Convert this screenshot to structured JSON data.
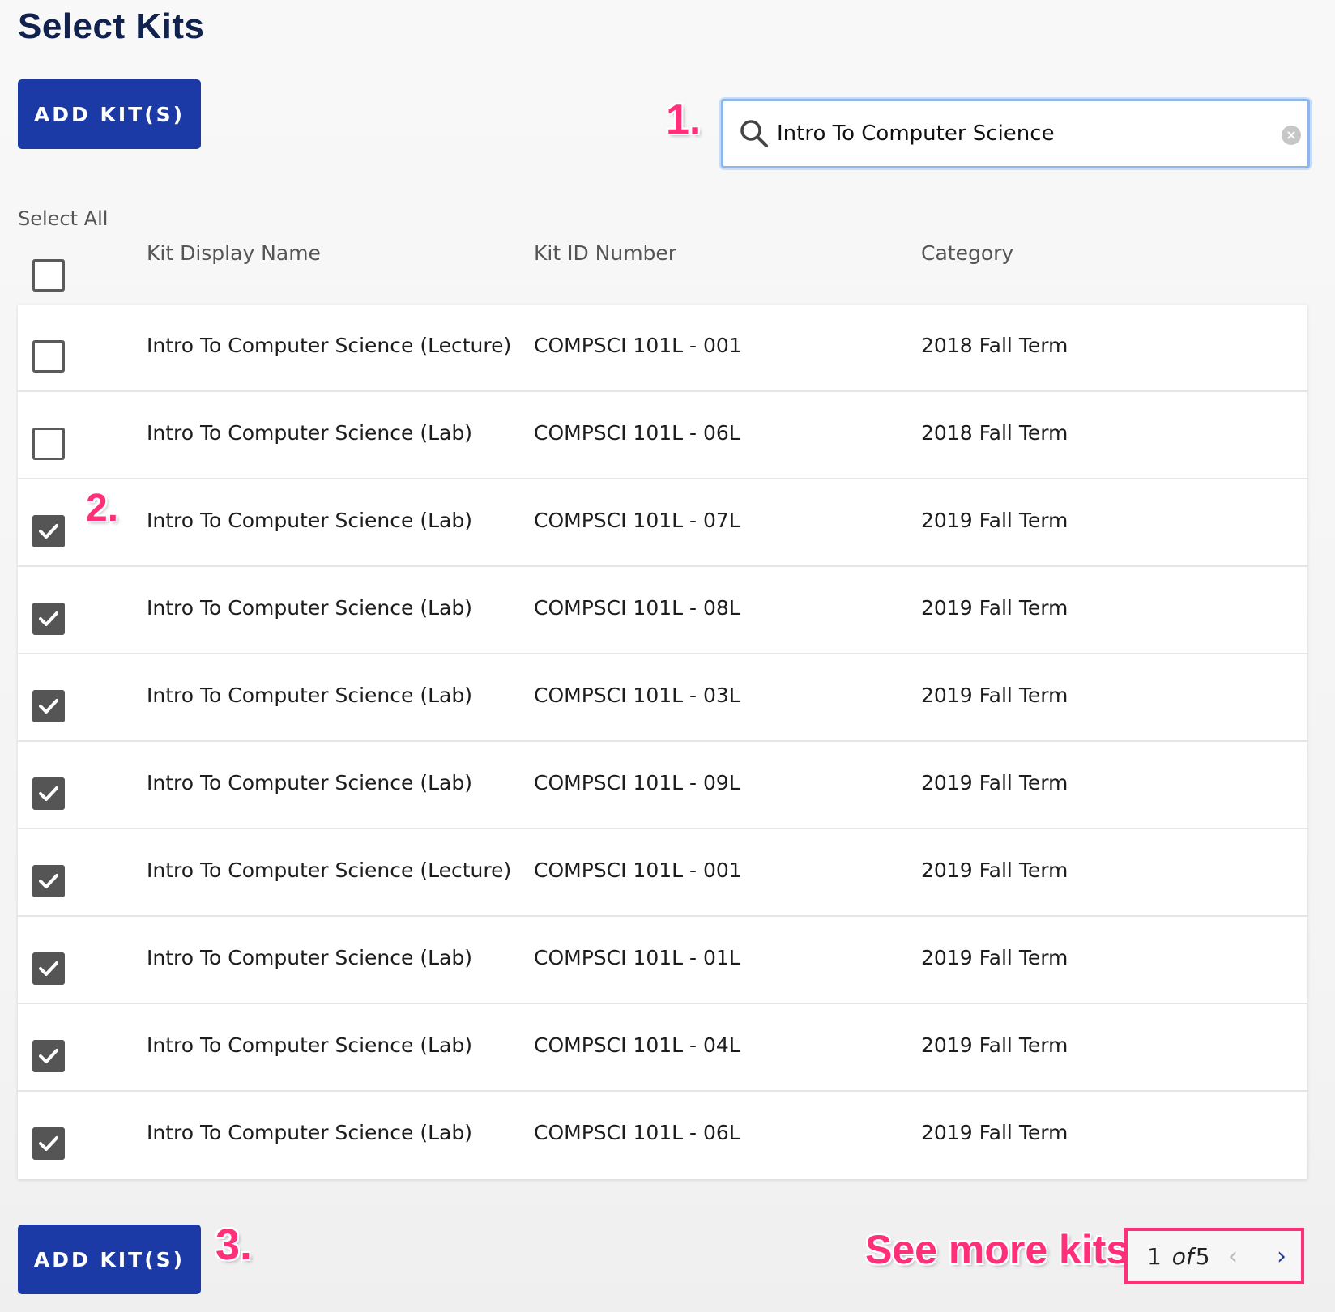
{
  "page_title": "Select Kits",
  "add_button_label": "ADD KIT(S)",
  "annotations": {
    "step1": "1.",
    "step2": "2.",
    "step3": "3.",
    "see_more": "See more kits"
  },
  "search": {
    "value": "Intro To Computer Science",
    "icon": "search-icon",
    "clear_icon": "clear-icon"
  },
  "select_all_label": "Select All",
  "select_all_checked": false,
  "columns": {
    "name": "Kit Display Name",
    "id": "Kit ID Number",
    "category": "Category"
  },
  "rows": [
    {
      "checked": false,
      "name": "Intro To Computer Science (Lecture)",
      "id": "COMPSCI 101L - 001",
      "category": "2018 Fall Term"
    },
    {
      "checked": false,
      "name": "Intro To Computer Science (Lab)",
      "id": "COMPSCI 101L - 06L",
      "category": "2018 Fall Term"
    },
    {
      "checked": true,
      "name": "Intro To Computer Science (Lab)",
      "id": "COMPSCI 101L - 07L",
      "category": "2019 Fall Term"
    },
    {
      "checked": true,
      "name": "Intro To Computer Science (Lab)",
      "id": "COMPSCI 101L - 08L",
      "category": "2019 Fall Term"
    },
    {
      "checked": true,
      "name": "Intro To Computer Science (Lab)",
      "id": "COMPSCI 101L - 03L",
      "category": "2019 Fall Term"
    },
    {
      "checked": true,
      "name": "Intro To Computer Science (Lab)",
      "id": "COMPSCI 101L - 09L",
      "category": "2019 Fall Term"
    },
    {
      "checked": true,
      "name": "Intro To Computer Science (Lecture)",
      "id": "COMPSCI 101L - 001",
      "category": "2019 Fall Term"
    },
    {
      "checked": true,
      "name": "Intro To Computer Science (Lab)",
      "id": "COMPSCI 101L - 01L",
      "category": "2019 Fall Term"
    },
    {
      "checked": true,
      "name": "Intro To Computer Science (Lab)",
      "id": "COMPSCI 101L - 04L",
      "category": "2019 Fall Term"
    },
    {
      "checked": true,
      "name": "Intro To Computer Science (Lab)",
      "id": "COMPSCI 101L - 06L",
      "category": "2019 Fall Term"
    }
  ],
  "pagination": {
    "current": "1",
    "of": "of",
    "total": "5",
    "prev_icon": "chevron-left-icon",
    "next_icon": "chevron-right-icon"
  },
  "colors": {
    "primary": "#1b3aa6",
    "title": "#12224f",
    "annotation": "#ff2f7a"
  }
}
